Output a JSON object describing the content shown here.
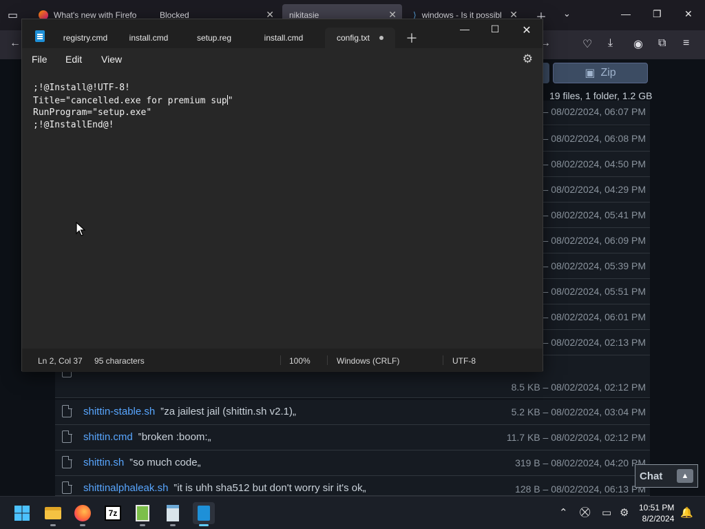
{
  "firefox": {
    "tabs": [
      {
        "title": "What's new with Firefo",
        "active": false
      },
      {
        "title": "Blocked",
        "active": false
      },
      {
        "title": "nikitasie",
        "active": true
      },
      {
        "title": "windows - Is it possibl",
        "active": false
      }
    ],
    "new_tab_icon": "plus-icon",
    "list_tabs_icon": "chevron-down-icon"
  },
  "github": {
    "zip_label": "Zip",
    "summary": "19 files, 1 folder, 1.2 GB",
    "rows_meta": [
      "– 08/02/2024, 06:07 PM",
      "– 08/02/2024, 06:08 PM",
      "– 08/02/2024, 04:50 PM",
      "– 08/02/2024, 04:29 PM",
      "– 08/02/2024, 05:41 PM",
      "– 08/02/2024, 06:09 PM",
      "– 08/02/2024, 05:39 PM",
      "– 08/02/2024, 05:51 PM",
      "– 08/02/2024, 06:01 PM",
      "– 08/02/2024, 02:13 PM"
    ],
    "files": [
      {
        "name": "",
        "desc": "",
        "meta": "8.5 KB – 08/02/2024, 02:12 PM"
      },
      {
        "name": "shittin-stable.sh",
        "desc": "‟za jailest jail (shittin.sh v2.1)„",
        "meta": "5.2 KB – 08/02/2024, 03:04 PM"
      },
      {
        "name": "shittin.cmd",
        "desc": "‟broken :boom:„",
        "meta": "11.7 KB – 08/02/2024, 02:12 PM"
      },
      {
        "name": "shittin.sh",
        "desc": "‟so much code„",
        "meta": "319 B – 08/02/2024, 04:20 PM"
      },
      {
        "name": "shittinalphaleak.sh",
        "desc": "‟it is uhh sha512 but don't worry sir it's ok„",
        "meta": "128 B – 08/02/2024, 06:13 PM"
      }
    ],
    "chat_label": "Chat"
  },
  "notepad": {
    "tabs": [
      {
        "label": "registry.cmd"
      },
      {
        "label": "install.cmd"
      },
      {
        "label": "setup.reg"
      },
      {
        "label": "install.cmd"
      },
      {
        "label": "config.txt",
        "active": true,
        "unsaved": true
      }
    ],
    "menu": {
      "file": "File",
      "edit": "Edit",
      "view": "View"
    },
    "content": [
      ";!@Install@!UTF-8!",
      "Title=\"cancelled.exe for premium sup",
      "RunProgram=\"setup.exe\"",
      ";!@InstallEnd@!"
    ],
    "content_line2_tail": "\"",
    "status": {
      "position": "Ln 2, Col 37",
      "characters": "95 characters",
      "zoom": "100%",
      "line_ending": "Windows (CRLF)",
      "encoding": "UTF-8"
    }
  },
  "taskbar": {
    "time": "10:51 PM",
    "date": "8/2/2024",
    "apps": [
      "start-icon",
      "file-explorer-icon",
      "firefox-icon",
      "7zip-icon",
      "archive-icon",
      "notepad-old-icon",
      "notepad-icon"
    ]
  },
  "colors": {
    "notepad_bg": "#272727",
    "accent": "#60cdff",
    "link": "#58a6ff"
  }
}
